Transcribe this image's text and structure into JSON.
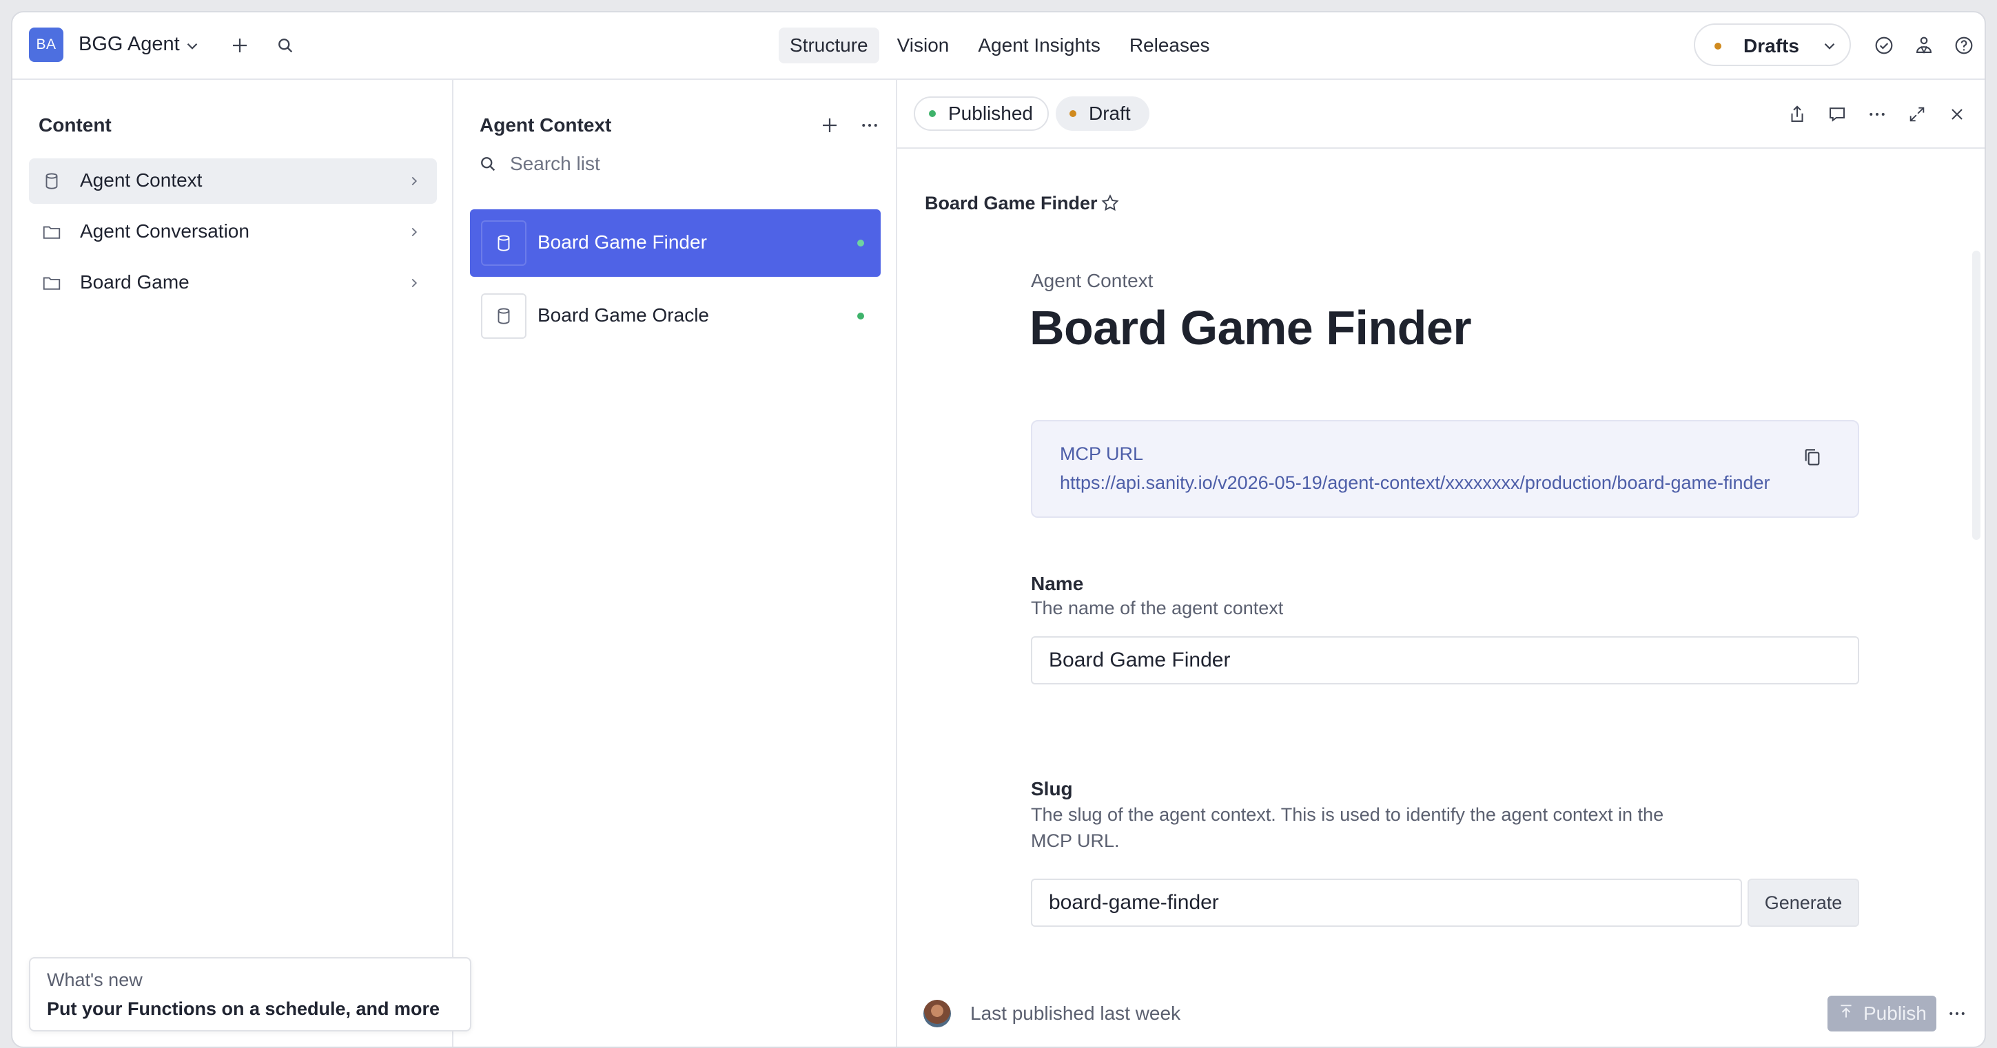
{
  "topnav": {
    "workspace_initials": "BA",
    "workspace_name": "BGG Agent",
    "tabs": [
      {
        "label": "Structure",
        "active": true
      },
      {
        "label": "Vision",
        "active": false
      },
      {
        "label": "Agent Insights",
        "active": false
      },
      {
        "label": "Releases",
        "active": false
      }
    ],
    "perspective_label": "Drafts",
    "perspective_dot_color": "#d08a1e"
  },
  "content_pane": {
    "title": "Content",
    "items": [
      {
        "label": "Agent Context",
        "icon": "database-icon",
        "active": true
      },
      {
        "label": "Agent Conversation",
        "icon": "folder-icon",
        "active": false
      },
      {
        "label": "Board Game",
        "icon": "folder-icon",
        "active": false
      }
    ]
  },
  "list_pane": {
    "title": "Agent Context",
    "search_placeholder": "Search list",
    "items": [
      {
        "label": "Board Game Finder",
        "active": true,
        "status_color": "#6fd3a0"
      },
      {
        "label": "Board Game Oracle",
        "active": false,
        "status_color": "#3fb36b"
      }
    ]
  },
  "doc_pane": {
    "status": {
      "published_label": "Published",
      "published_color": "#3fb36b",
      "draft_label": "Draft",
      "draft_color": "#d08a1e"
    },
    "header_title": "Board Game Finder",
    "doc_type": "Agent Context",
    "doc_title": "Board Game Finder",
    "mcp": {
      "label": "MCP URL",
      "url": "https://api.sanity.io/v2026-05-19/agent-context/xxxxxxxx/production/board-game-finder"
    },
    "fields": {
      "name": {
        "label": "Name",
        "description": "The name of the agent context",
        "value": "Board Game Finder"
      },
      "slug": {
        "label": "Slug",
        "description_line1": "The slug of the agent context. This is used to identify the agent context in the",
        "description_line2": "MCP URL.",
        "value": "board-game-finder",
        "generate_label": "Generate"
      }
    },
    "footer": {
      "last_published": "Last published last week",
      "publish_label": "Publish"
    }
  },
  "whats_new": {
    "title": "What's new",
    "text": "Put your Functions on a schedule, and more"
  }
}
